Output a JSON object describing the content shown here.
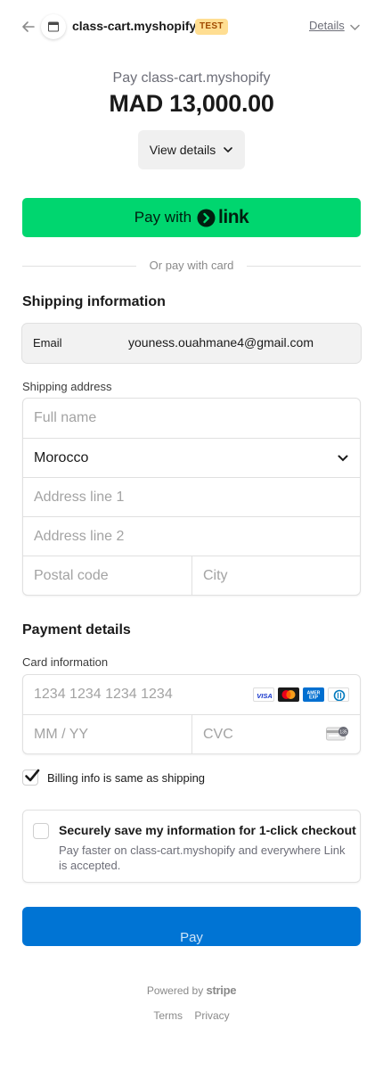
{
  "header": {
    "store_name": "class-cart.myshopify",
    "test_badge": "TEST",
    "details_label": "Details",
    "icons": [
      "arrow-left-icon",
      "store-icon",
      "chevron-down-icon"
    ]
  },
  "summary": {
    "pay_to": "Pay class-cart.myshopify",
    "amount": "MAD 13,000.00",
    "view_details": "View details"
  },
  "link_button": {
    "prefix": "Pay with",
    "brand": "link",
    "color": "#00d66f"
  },
  "divider_text": "Or pay with card",
  "shipping": {
    "title": "Shipping information",
    "email_label": "Email",
    "email_value": "youness.ouahmane4@gmail.com",
    "address_label": "Shipping address",
    "full_name_placeholder": "Full name",
    "country_value": "Morocco",
    "address1_placeholder": "Address line 1",
    "address2_placeholder": "Address line 2",
    "postal_placeholder": "Postal code",
    "city_placeholder": "City"
  },
  "payment": {
    "title": "Payment details",
    "card_label": "Card information",
    "card_number_placeholder": "1234 1234 1234 1234",
    "expiry_placeholder": "MM / YY",
    "cvc_placeholder": "CVC",
    "card_brands": [
      "visa-icon",
      "mastercard-icon",
      "amex-icon",
      "diners-icon"
    ],
    "billing_same_label": "Billing info is same as shipping",
    "billing_same_checked": true
  },
  "save_info": {
    "title": "Securely save my information for 1-click checkout",
    "description": "Pay faster on class-cart.myshopify and everywhere Link is accepted.",
    "checked": false
  },
  "pay_button": {
    "label": "Pay",
    "color": "#0074d4"
  },
  "footer": {
    "powered_by": "Powered by",
    "brand": "stripe",
    "terms": "Terms",
    "privacy": "Privacy"
  }
}
